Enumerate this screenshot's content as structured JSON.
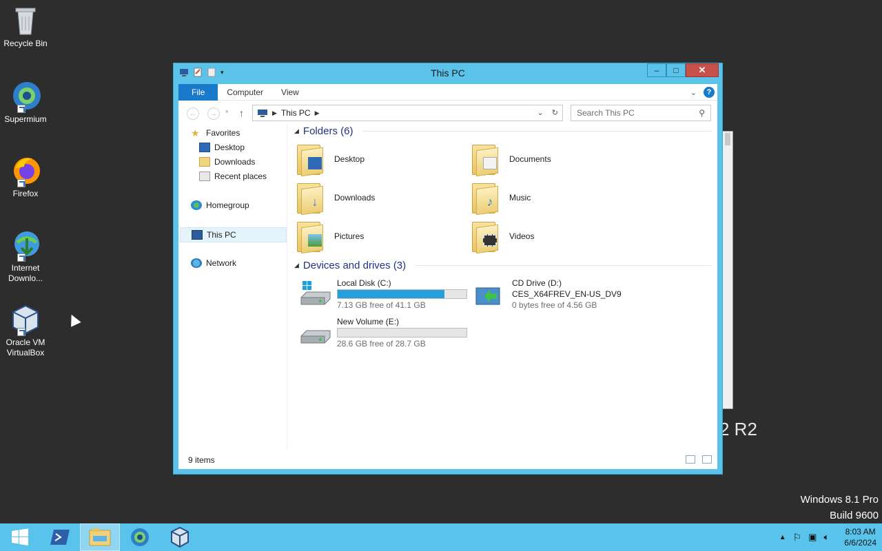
{
  "desktop": {
    "icons": [
      {
        "label": "Recycle Bin",
        "icon": "recycle-bin-icon"
      },
      {
        "label": "Supermium",
        "icon": "supermium-icon"
      },
      {
        "label": "Firefox",
        "icon": "firefox-icon"
      },
      {
        "label": "Internet Downlo...",
        "icon": "internet-download-manager-icon"
      },
      {
        "label": "Oracle VM VirtualBox",
        "icon": "virtualbox-icon"
      }
    ],
    "background_text": "2 R2",
    "watermark": {
      "line1": "Windows 8.1 Pro",
      "line2": "Build 9600"
    }
  },
  "window": {
    "title": "This PC",
    "controls": {
      "minimize": "‒",
      "maximize": "□",
      "close": "✕"
    },
    "ribbon": {
      "tabs": [
        "File",
        "Computer",
        "View"
      ],
      "help": "?"
    },
    "address": {
      "root_icon": "this-pc-icon",
      "crumb": "This PC"
    },
    "search": {
      "placeholder": "Search This PC"
    },
    "nav": {
      "favorites": "Favorites",
      "desktop": "Desktop",
      "downloads": "Downloads",
      "recent": "Recent places",
      "homegroup": "Homegroup",
      "this_pc": "This PC",
      "network": "Network"
    },
    "folders_header": "Folders (6)",
    "folders": [
      {
        "name": "Desktop",
        "icon": "desktop-folder-icon"
      },
      {
        "name": "Documents",
        "icon": "documents-folder-icon"
      },
      {
        "name": "Downloads",
        "icon": "downloads-folder-icon"
      },
      {
        "name": "Music",
        "icon": "music-folder-icon"
      },
      {
        "name": "Pictures",
        "icon": "pictures-folder-icon"
      },
      {
        "name": "Videos",
        "icon": "videos-folder-icon"
      }
    ],
    "drives_header": "Devices and drives (3)",
    "drives": [
      {
        "name": "Local Disk (C:)",
        "free": "7.13 GB free of 41.1 GB",
        "used_fraction": 0.83
      },
      {
        "name": "CD Drive (D:)",
        "label2": "CES_X64FREV_EN-US_DV9",
        "free": "0 bytes free of 4.56 GB"
      },
      {
        "name": "New Volume (E:)",
        "free": "28.6 GB free of 28.7 GB",
        "used_fraction": 0.0
      }
    ],
    "status": "9 items"
  },
  "taskbar": {
    "clock_time": "8:03 AM",
    "clock_date": "6/6/2024"
  },
  "colors": {
    "accent": "#1979ca",
    "taskbar": "#59c3eb",
    "window_frame": "#5bc3ea",
    "drive_fill": "#26a0da"
  }
}
